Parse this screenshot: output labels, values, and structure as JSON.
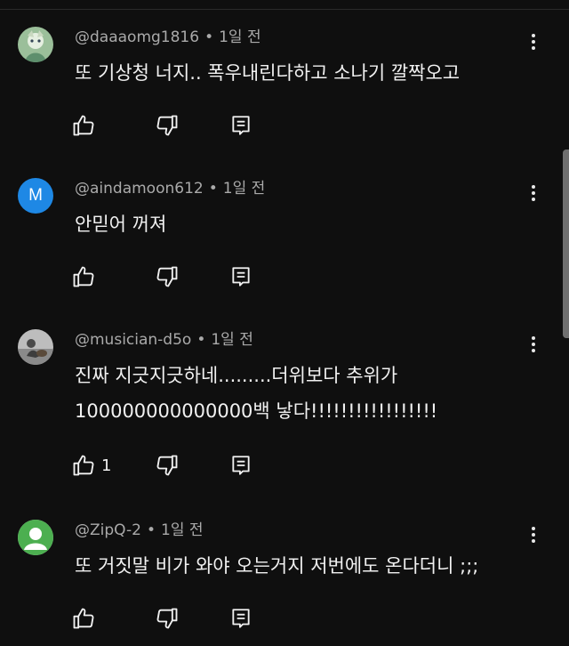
{
  "comments": [
    {
      "author": "@daaaomg1816",
      "time": "1일 전",
      "lines": [
        "또 기상청 너지.. 폭우내린다하고 소나기 깔짝오고"
      ],
      "likes": "",
      "avatar": {
        "type": "image",
        "colors": [
          "#7aa38a",
          "#cfe0c9"
        ]
      }
    },
    {
      "author": "@aindamoon612",
      "time": "1일 전",
      "lines": [
        "안믿어 꺼져"
      ],
      "likes": "",
      "avatar": {
        "type": "letter",
        "letter": "M",
        "color": "#1e88e5"
      }
    },
    {
      "author": "@musician-d5o",
      "time": "1일 전",
      "lines": [
        "진짜 지긋지긋하네.........더위보다 추위가",
        "100000000000000백 낳다!!!!!!!!!!!!!!!!!"
      ],
      "likes": "1",
      "avatar": {
        "type": "image",
        "colors": [
          "#b9b9b9",
          "#6b6b6b"
        ]
      }
    },
    {
      "author": "@ZipQ-2",
      "time": "1일 전",
      "lines": [
        "또 거짓말 비가 와야 오는거지 저번에도 온다더니 ;;;"
      ],
      "likes": "",
      "avatar": {
        "type": "generic",
        "color": "#4caf50"
      }
    }
  ],
  "icons": {
    "like": "thumb-up-icon",
    "dislike": "thumb-down-icon",
    "reply": "reply-icon",
    "more": "more-vert-icon"
  }
}
